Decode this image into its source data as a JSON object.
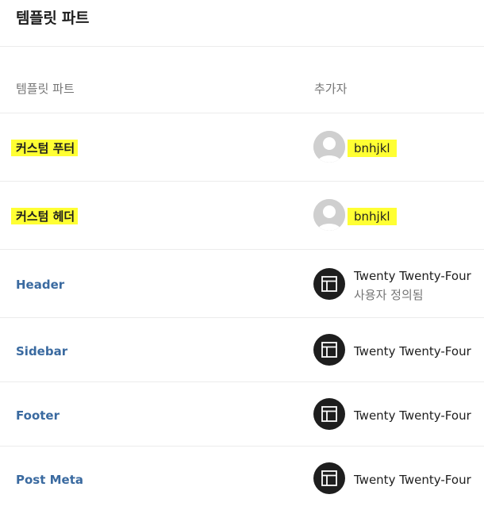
{
  "page": {
    "title": "템플릿 파트"
  },
  "table": {
    "headers": {
      "part": "템플릿 파트",
      "author": "추가자"
    },
    "rows": [
      {
        "title": "커스텀 푸터",
        "author": "bnhjkl",
        "author_type": "user",
        "highlighted": true
      },
      {
        "title": "커스텀 헤더",
        "author": "bnhjkl",
        "author_type": "user",
        "highlighted": true
      },
      {
        "title": "Header",
        "author": "Twenty Twenty-Four",
        "author_note": "사용자 정의됨",
        "author_type": "theme"
      },
      {
        "title": "Sidebar",
        "author": "Twenty Twenty-Four",
        "author_type": "theme"
      },
      {
        "title": "Footer",
        "author": "Twenty Twenty-Four",
        "author_type": "theme"
      },
      {
        "title": "Post Meta",
        "author": "Twenty Twenty-Four",
        "author_type": "theme"
      }
    ]
  },
  "icons": {
    "user": "default-avatar-icon",
    "theme": "layout-icon"
  },
  "colors": {
    "link": "#3a6aa0",
    "highlight": "#ffff33",
    "theme_icon_bg": "#1e1e1e",
    "muted": "#757575"
  }
}
